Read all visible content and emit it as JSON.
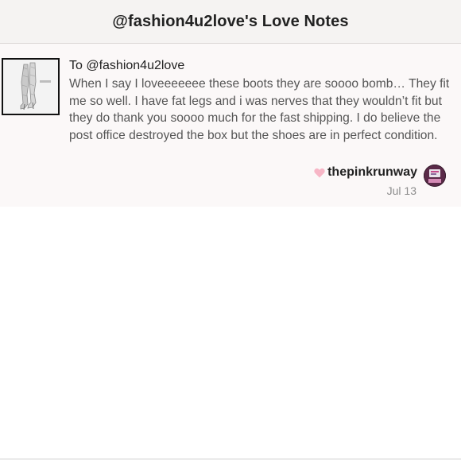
{
  "header": {
    "title": "@fashion4u2love's Love Notes"
  },
  "note": {
    "thumbnail_icon": "boots-photo",
    "recipient": "To @fashion4u2love",
    "message": "When I say I loveeeeeee these boots they are soooo bomb… They fit me so well. I have fat legs and i was nerves that they wouldn’t fit but they do thank you soooo much for the fast shipping. I do believe the post office destroyed the box but the shoes are in perfect condition.",
    "author": {
      "heart_icon": "heart-icon",
      "heart_color": "#f7b6c6",
      "username": "thepinkrunway",
      "avatar_icon": "user-avatar"
    },
    "date": "Jul 13"
  }
}
